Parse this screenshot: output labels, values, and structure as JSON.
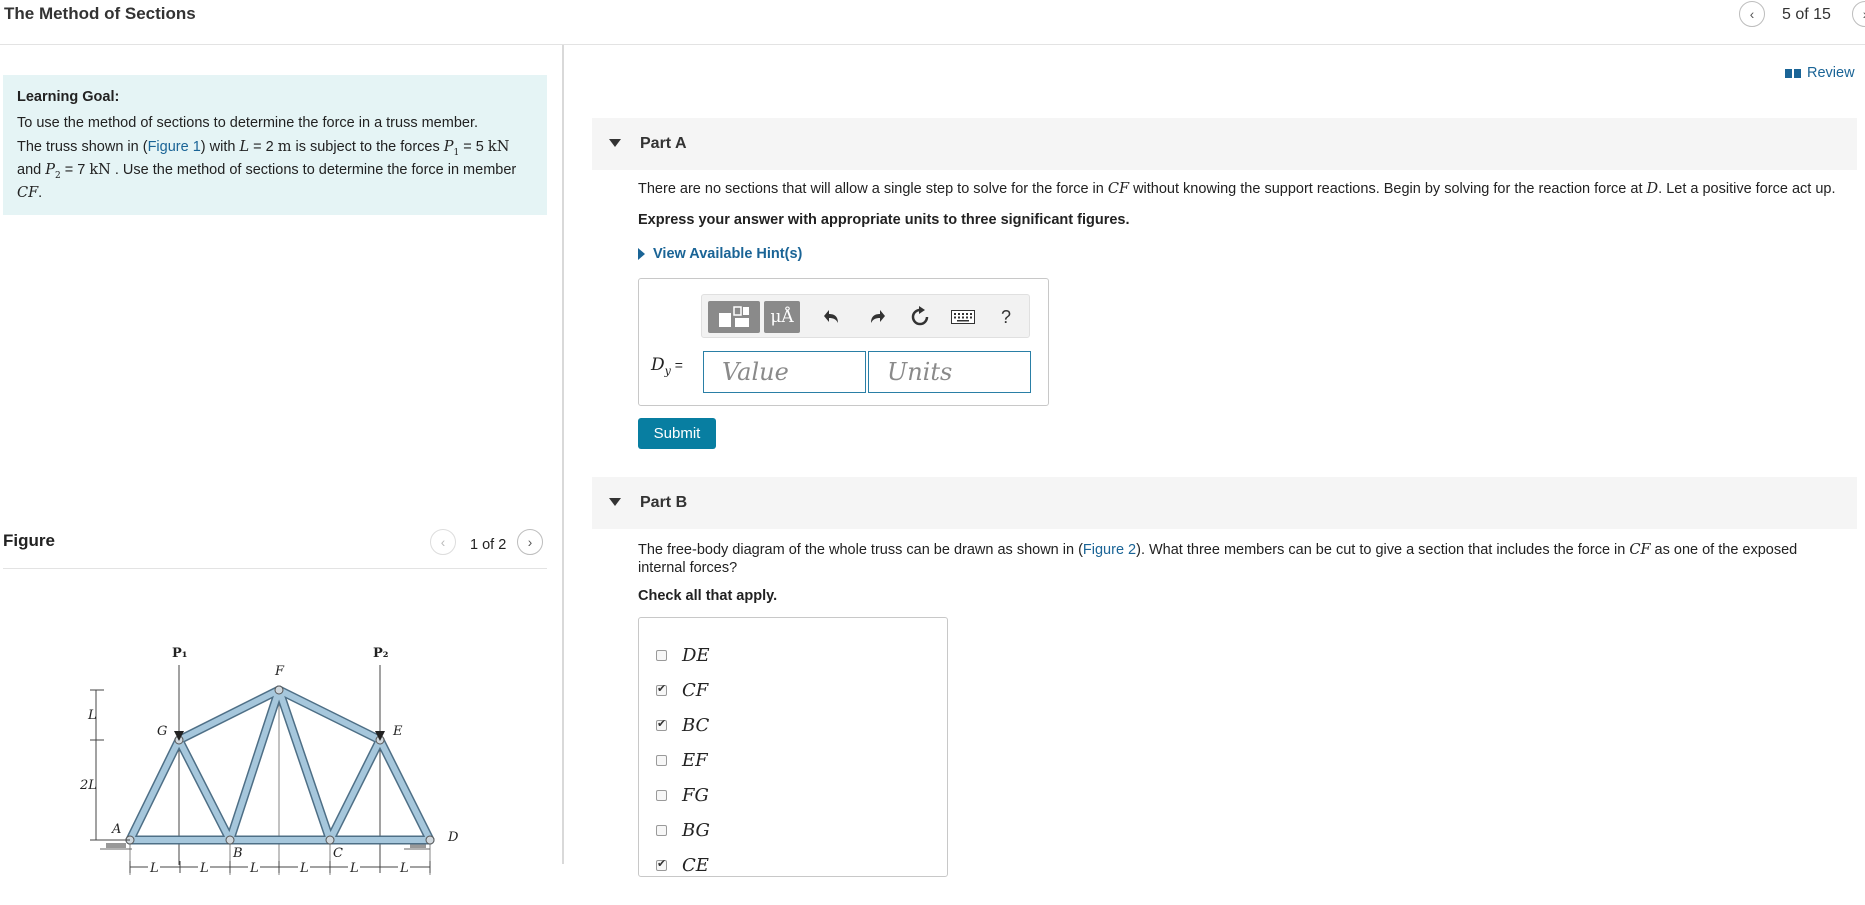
{
  "header": {
    "title": "The Method of Sections",
    "counter": "5 of 15"
  },
  "left": {
    "goal_heading": "Learning Goal:",
    "goal_text": "To use the method of sections to determine the force in a truss member.",
    "desc": {
      "t1": "The truss shown in (",
      "figure_link": "Figure 1",
      "t2": ") with ",
      "L": "L",
      "t3": " = 2 ",
      "m": "m",
      "t4": " is subject to the forces ",
      "P1": "P",
      "P1_sub": "1",
      "t5": " = 5 ",
      "kN1": "kN",
      "t6": " and ",
      "P2": "P",
      "P2_sub": "2",
      "t7": " = 7 ",
      "kN2": "kN",
      "t8": " . Use the method of sections to determine the force in member ",
      "CF": "CF",
      "t9": "."
    },
    "figure_heading": "Figure",
    "figure_counter": "1 of 2",
    "truss_labels": {
      "P1": "P₁",
      "P2": "P₂",
      "F": "F",
      "G": "G",
      "E": "E",
      "A": "A",
      "B": "B",
      "C": "C",
      "D": "D",
      "L": "L",
      "twoL": "2L",
      "dims": [
        "L",
        "L",
        "L",
        "L",
        "L",
        "L"
      ]
    }
  },
  "review": "Review",
  "partA": {
    "title": "Part A",
    "text": {
      "t1": "There are no sections that will allow a single step to solve for the force in ",
      "CF": "CF",
      "t2": " without knowing the support reactions. Begin by solving for the reaction force at ",
      "D": "D",
      "t3": ". Let a positive force act up."
    },
    "instruction": "Express your answer with appropriate units to three significant figures.",
    "hints": "View Available Hint(s)",
    "toolbar": {
      "units": "μÅ",
      "help": "?"
    },
    "label_var": "D",
    "label_sub": "y",
    "label_eq": " =",
    "value_placeholder": "Value",
    "units_placeholder": "Units",
    "submit": "Submit"
  },
  "partB": {
    "title": "Part B",
    "text": {
      "t1": "The free-body diagram of the whole truss can be drawn as shown in (",
      "figure_link": "Figure 2",
      "t2": "). What three members can be cut to give a section that includes the force in ",
      "CF": "CF",
      "t3": " as one of the exposed internal forces?"
    },
    "instruction": "Check all that apply.",
    "options": [
      {
        "label": "DE",
        "checked": false
      },
      {
        "label": "CF",
        "checked": true
      },
      {
        "label": "BC",
        "checked": true
      },
      {
        "label": "EF",
        "checked": false
      },
      {
        "label": "FG",
        "checked": false
      },
      {
        "label": "BG",
        "checked": false
      },
      {
        "label": "CE",
        "checked": true
      }
    ]
  }
}
